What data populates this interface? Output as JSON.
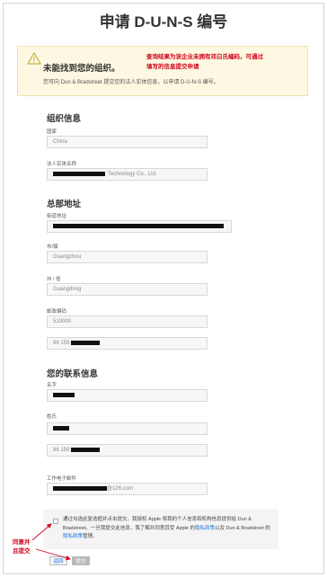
{
  "page_title": "申请 D-U-N-S 编号",
  "alert": {
    "title": "未能找到您的组织。",
    "description": "您可向 Dun & Bradstreet 提交您的法人实体信息，以申请 D-U-N-S 编号。",
    "icon": "warning-icon"
  },
  "annotations": {
    "top_line1": "查询结果为该企业未拥有邓白氏编码，可通过",
    "top_line2": "填写的信息提交申请",
    "bottom_line1": "同意并",
    "bottom_line2": "且提交"
  },
  "org_section": {
    "heading": "组织信息",
    "country_label": "国家",
    "country_value": "China",
    "legal_name_label": "法人实体名称",
    "legal_name_suffix": "Technology Co., Ltd."
  },
  "hq_section": {
    "heading": "总部地址",
    "street_label": "街道地址",
    "city_label": "市/镇",
    "city_value": "Guangzhou",
    "province_label": "州 / 省",
    "province_value": "Guangdong",
    "postal_label": "邮政编码",
    "postal_value": "510000",
    "phone_prefix": "86 159"
  },
  "contact_section": {
    "heading": "您的联系信息",
    "first_name_label": "名字",
    "last_name_label": "姓氏",
    "phone_prefix": "86 159",
    "email_label": "工作电子邮件",
    "email_suffix": "@126.com"
  },
  "agreement": {
    "text_before_link1": "通过勾选此复选框并点击提交，我授权 Apple 将我的个人信息和机构信息提供给 Dun & Bradstreet。一旦我提交此信息，我了解并同意其受 Apple 的",
    "link1": "隐私政策",
    "text_between": "以及 Dun & Bradstreet 的",
    "link2": "隐私政策",
    "text_after": "管理。"
  },
  "buttons": {
    "back_label": "返回",
    "submit_label": "提交"
  },
  "colors": {
    "annotation": "#d0021b",
    "link": "#1a73d9",
    "alert_bg": "#fdf8e1"
  }
}
